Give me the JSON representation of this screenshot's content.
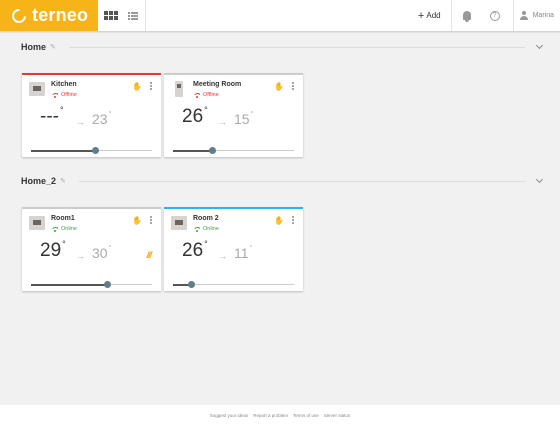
{
  "header": {
    "logo_text": "terneo",
    "brand_color": "#f6b419",
    "add_label": "Add",
    "add_symbol": "+",
    "help_symbol": "?",
    "user_name": "Marina"
  },
  "groups": [
    {
      "title": "Home",
      "devices": [
        {
          "name": "Kitchen",
          "status": "Offline",
          "status_color": "#e53935",
          "current": "---",
          "target": "23",
          "accent": "#e53935",
          "icon": "thermostat-icon",
          "slider": 0.53,
          "heating": ""
        },
        {
          "name": "Meeting Room",
          "status": "Offline",
          "status_color": "#e53935",
          "current": "26",
          "target": "15",
          "accent": "#cccccc",
          "icon": "thermostat-tall-icon",
          "slider": 0.33,
          "heating": ""
        }
      ]
    },
    {
      "title": "Home_2",
      "devices": [
        {
          "name": "Room1",
          "status": "Online",
          "status_color": "#43a047",
          "current": "29",
          "target": "30",
          "accent": "#cccccc",
          "icon": "thermostat-icon",
          "slider": 0.63,
          "heating": "///"
        },
        {
          "name": "Room 2",
          "status": "Online",
          "status_color": "#43a047",
          "current": "26",
          "target": "11",
          "accent": "#29b6f6",
          "icon": "thermostat-icon",
          "slider": 0.15,
          "heating": ""
        }
      ]
    }
  ],
  "footer": {
    "links": [
      "Suggest your ideas",
      "Report a problem",
      "Terms of use",
      "Server status"
    ]
  }
}
